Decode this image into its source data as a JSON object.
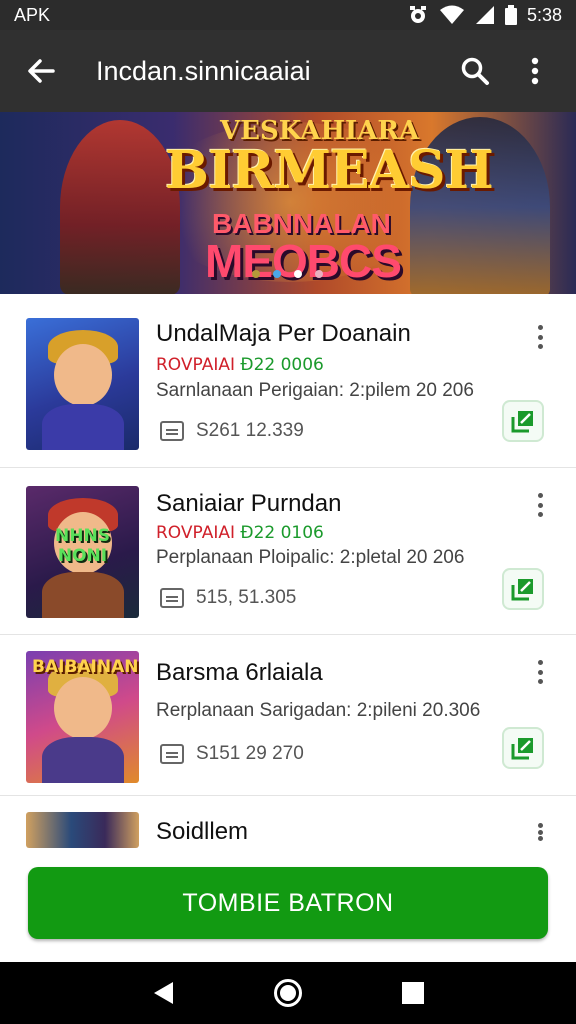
{
  "status_bar": {
    "carrier": "APK",
    "time": "5:38"
  },
  "app_bar": {
    "title": "Incdan.sinnicaaiai"
  },
  "banner": {
    "line1": "VESKAHIARA",
    "line2": "BIRMEASH",
    "line3": "BABNNALAN",
    "line4": "MEOBCS",
    "active_dot": 2
  },
  "items": [
    {
      "name": "UndalMaja Per Doanain",
      "price_red": "ROVPAIAI",
      "price_green": "Ð22 0006",
      "description": "Sarnlanaan Perigaian: 2:pilem 20 206",
      "meta": "S261  12.339",
      "thumb_caption": "",
      "thumb_colors": [
        "#3a6fd8",
        "#d8a02a",
        "#3b3ba8"
      ]
    },
    {
      "name": "Saniaiar Purndan",
      "price_red": "ROVPAIAI",
      "price_green": "Ð22 0106",
      "description": "Perplanaan Ploipalic: 2:pletal 20 206",
      "meta": "515,  51.305",
      "thumb_caption": "NHNS NONI",
      "thumb_colors": [
        "#5a2a6a",
        "#c0392b",
        "#8a4a2a"
      ]
    },
    {
      "name": "Barsma 6rlaiala",
      "price_red": "",
      "price_green": "",
      "description": "Rerplanaan Sarigadan: 2:pileni 20.306",
      "meta": "S151  29 270",
      "thumb_caption": "BAIBAINAN",
      "thumb_colors": [
        "#7a3fb0",
        "#e0b040",
        "#4a3a8a"
      ]
    },
    {
      "name": "Soidllem",
      "price_red": "",
      "price_green": "",
      "description": "",
      "meta": "",
      "thumb_caption": "",
      "thumb_colors": [
        "#2a4a7a",
        "#d0a060",
        "#3a2a5a"
      ]
    }
  ],
  "cta": {
    "label": "TOMBIE BATRON"
  },
  "colors": {
    "app_bar": "#303030",
    "cta": "#129a12",
    "price_red": "#d0202a",
    "price_green": "#1b9a2c"
  }
}
